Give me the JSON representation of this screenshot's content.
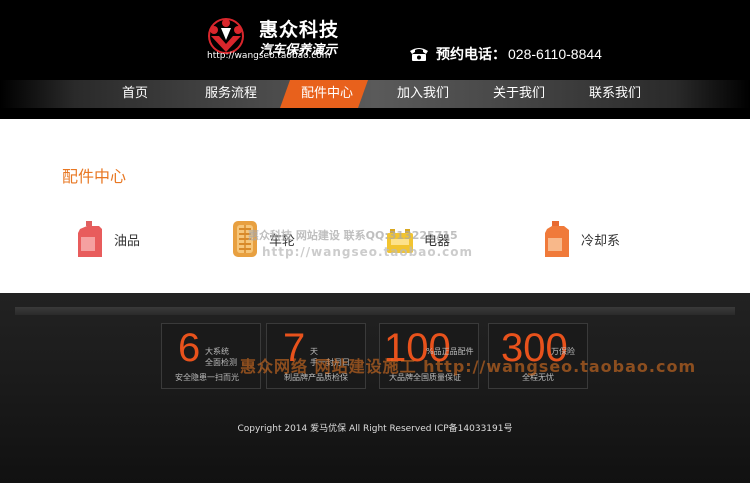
{
  "header": {
    "logo": {
      "title": "惠众科技",
      "subtitle": "汽车保养演示",
      "url": "http://wangseo.taobao.com"
    },
    "phone": {
      "label": "预约电话：",
      "number": "028-6110-8844",
      "icon": "phone-icon"
    }
  },
  "nav": {
    "items": [
      {
        "label": "首页"
      },
      {
        "label": "服务流程"
      },
      {
        "label": "配件中心",
        "active": true
      },
      {
        "label": "加入我们"
      },
      {
        "label": "关于我们"
      },
      {
        "label": "联系我们"
      }
    ],
    "active_color": "#e8611c"
  },
  "main": {
    "title": "配件中心",
    "categories": [
      {
        "label": "油品",
        "icon": "oil-can-icon"
      },
      {
        "label": "车轮",
        "icon": "tire-icon"
      },
      {
        "label": "电器",
        "icon": "battery-icon"
      },
      {
        "label": "冷却系",
        "icon": "coolant-icon"
      }
    ],
    "watermark": {
      "line1": "惠众科技  网站建设  联系QQ:313225715",
      "line2": "http://wangseo.taobao.com"
    }
  },
  "footer": {
    "stats": [
      {
        "number": "6",
        "top": "大系统\n全面检测",
        "bottom": "安全隐患一扫而光"
      },
      {
        "number": "7",
        "top": "天\n手一封月日",
        "bottom": "制品牌产品质检保"
      },
      {
        "number": "100",
        "top": "%品正品配件",
        "bottom": "大品牌全国质量保证"
      },
      {
        "number": "300",
        "top": "万保险",
        "bottom": "全程无忧"
      }
    ],
    "watermark": "惠众网络 网站建设施工 http://wangseo.taobao.com",
    "copyright": "Copyright 2014 爱马优保 All Right Reserved ICP备14033191号"
  },
  "colors": {
    "accent": "#e87722",
    "stat_number": "#e8521c"
  }
}
